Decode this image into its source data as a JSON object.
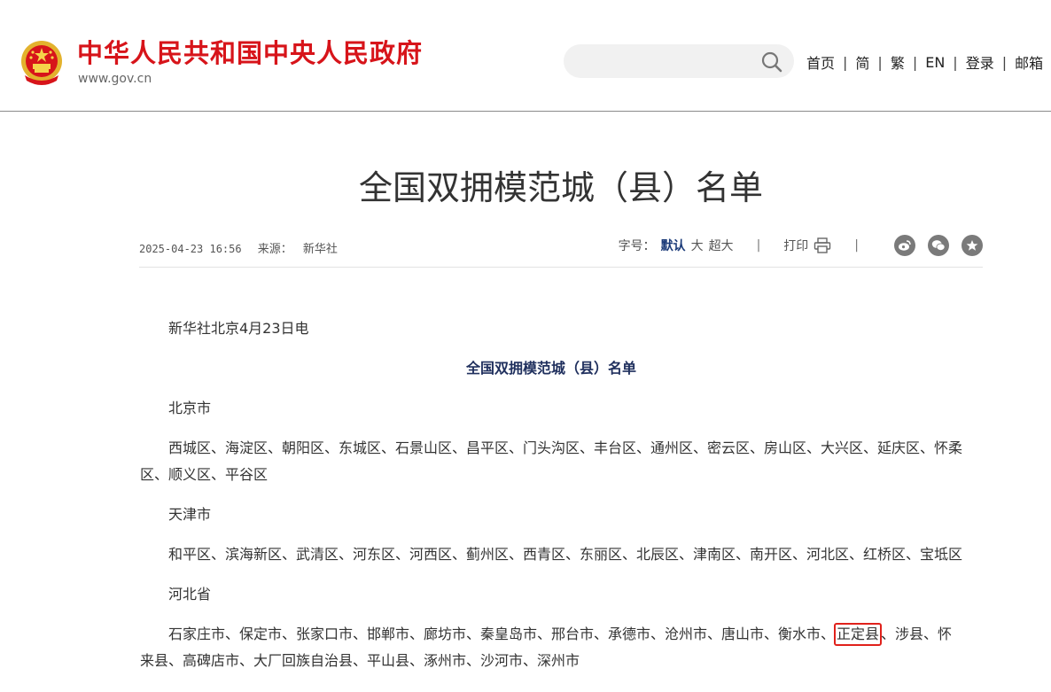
{
  "header": {
    "site_name": "中华人民共和国中央人民政府",
    "site_url": "www.gov.cn",
    "search": {
      "placeholder": ""
    },
    "nav": [
      "首页",
      "简",
      "繁",
      "EN",
      "登录",
      "邮箱"
    ]
  },
  "article": {
    "title": "全国双拥模范城（县）名单",
    "date": "2025-04-23 16:56",
    "source_label": "来源：",
    "source": "新华社",
    "font_size_label": "字号：",
    "font_sizes": [
      "默认",
      "大",
      "超大"
    ],
    "active_font_size": "默认",
    "print_label": "打印",
    "share_icons": [
      "weibo-icon",
      "wechat-icon",
      "favorite-icon"
    ],
    "dateline": "新华社北京4月23日电",
    "subtitle": "全国双拥模范城（县）名单",
    "sections": [
      {
        "region": "北京市",
        "list": "西城区、海淀区、朝阳区、东城区、石景山区、昌平区、门头沟区、丰台区、通州区、密云区、房山区、大兴区、延庆区、怀柔区、顺义区、平谷区"
      },
      {
        "region": "天津市",
        "list": "和平区、滨海新区、武清区、河东区、河西区、蓟州区、西青区、东丽区、北辰区、津南区、南开区、河北区、红桥区、宝坻区"
      },
      {
        "region": "河北省",
        "list_before": "石家庄市、保定市、张家口市、邯郸市、廊坊市、秦皇岛市、邢台市、承德市、沧州市、唐山市、衡水市、",
        "highlighted": "正定县",
        "list_after": "、涉县、怀来县、高碑店市、大厂回族自治县、平山县、涿州市、沙河市、深州市"
      }
    ]
  },
  "colors": {
    "brand_red": "#d7141a",
    "subtitle_blue": "#20305e",
    "highlight_box": "#e0211b"
  }
}
